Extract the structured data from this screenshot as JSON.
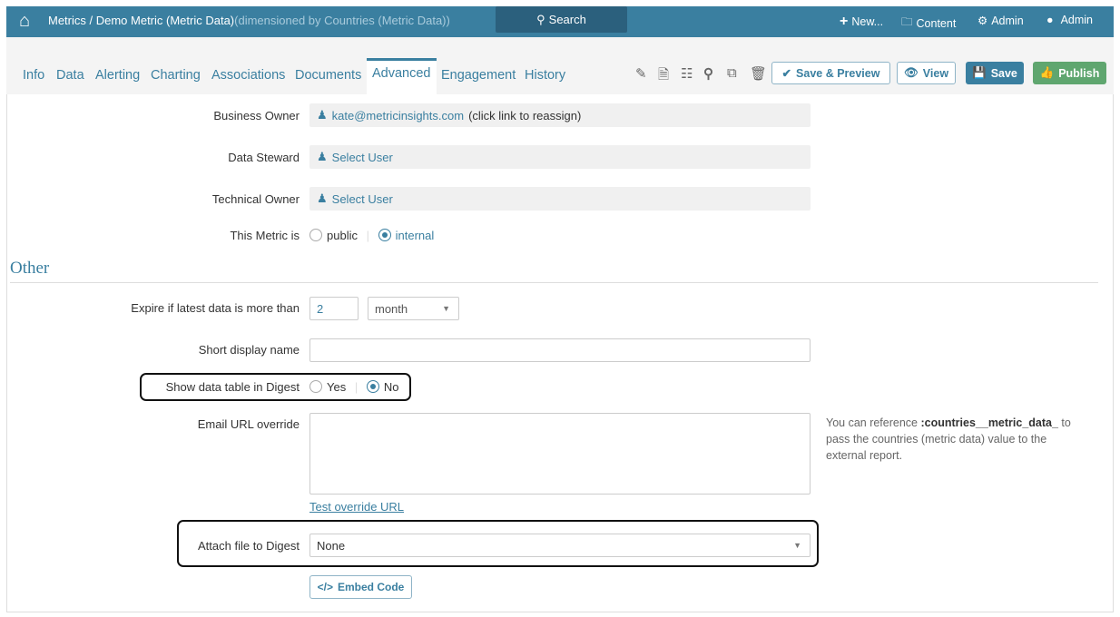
{
  "header": {
    "breadcrumb": "Metrics / Demo Metric (Metric Data)",
    "breadcrumb_dim": "(dimensioned by Countries (Metric Data))",
    "search": "Search",
    "new": "New...",
    "content": "Content",
    "admin_settings": "Admin",
    "admin_user": "Admin"
  },
  "tabs": [
    "Info",
    "Data",
    "Alerting",
    "Charting",
    "Associations",
    "Documents",
    "Advanced",
    "Engagement",
    "History"
  ],
  "active_tab": "Advanced",
  "toolbar": {
    "save_preview": "Save & Preview",
    "view": "View",
    "save": "Save",
    "publish": "Publish"
  },
  "form": {
    "business_owner": {
      "label": "Business Owner",
      "value": "kate@metricinsights.com",
      "hint": "(click link to reassign)"
    },
    "data_steward": {
      "label": "Data Steward",
      "value": "Select User"
    },
    "technical_owner": {
      "label": "Technical Owner",
      "value": "Select User"
    },
    "metric_is": {
      "label": "This Metric is",
      "options": [
        "public",
        "internal"
      ],
      "selected": "internal"
    },
    "section": "Other",
    "expire": {
      "label": "Expire if latest data is more than",
      "value": "2",
      "unit": "month"
    },
    "short_name": {
      "label": "Short display name",
      "value": ""
    },
    "show_table": {
      "label": "Show data table in Digest",
      "options": [
        "Yes",
        "No"
      ],
      "selected": "No"
    },
    "email_url": {
      "label": "Email URL override",
      "value": "",
      "help_pre": "You can reference ",
      "help_var": ":countries__metric_data_",
      "help_post": " to pass the countries (metric data) value to the external report.",
      "test_link": "Test override URL"
    },
    "attach": {
      "label": "Attach file to Digest",
      "value": "None"
    },
    "embed": "Embed Code"
  },
  "colors": {
    "brand": "#3a7fa0",
    "publish": "#5fa66f"
  }
}
